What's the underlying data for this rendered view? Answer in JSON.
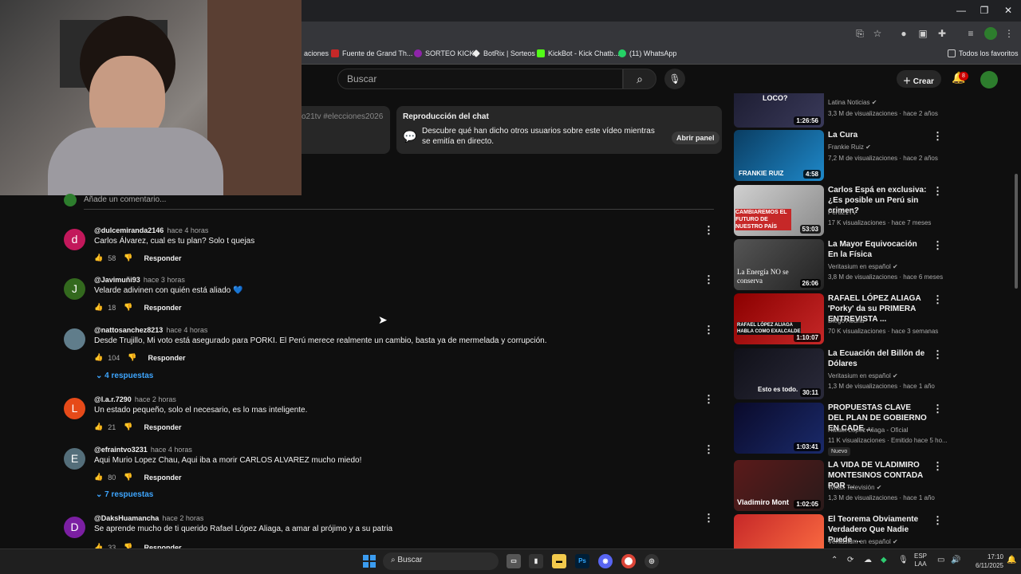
{
  "browser": {
    "bookmarks": [
      "aciones",
      "Fuente de Grand Th...",
      "SORTEO KICK",
      "BotRix | Sorteos",
      "KickBot - Kick Chatb...",
      "(11) WhatsApp"
    ],
    "all_bookmarks": "Todos los favoritos"
  },
  "header": {
    "search_placeholder": "Buscar",
    "create": "Crear",
    "notif_count": "8"
  },
  "chat_card": {
    "left_partial": "o21tv #elecciones2026",
    "title": "Reproducción del chat",
    "description": "Descubre qué han dicho otros usuarios sobre este vídeo mientras se emitía en directo.",
    "button": "Abrir panel"
  },
  "add_comment_placeholder": "Añade un comentario...",
  "comments": [
    {
      "initial": "d",
      "color": "#c2185b",
      "author": "@dulcemiranda2146",
      "time": "hace 4 horas",
      "text": "Carlos Álvarez, cual es tu plan? Solo t quejas",
      "likes": "58",
      "reply": "Responder"
    },
    {
      "initial": "J",
      "color": "#33691e",
      "author": "@Javimuñi93",
      "time": "hace 3 horas",
      "text": "Velarde adivinen con quién está aliado 💙",
      "likes": "18",
      "reply": "Responder"
    },
    {
      "initial": "",
      "color": "#607d8b",
      "author": "@nattosanchez8213",
      "time": "hace 4 horas",
      "text": "Desde Trujillo, Mi voto está asegurado para PORKI. El Perú merece realmente un cambio, basta ya de mermelada y corrupción.",
      "likes": "104",
      "reply": "Responder",
      "replies": "4 respuestas"
    },
    {
      "initial": "L",
      "color": "#e64a19",
      "author": "@l.a.r.7290",
      "time": "hace 2 horas",
      "text": "Un estado pequeño, solo el necesario, es lo mas inteligente.",
      "likes": "21",
      "reply": "Responder"
    },
    {
      "initial": "E",
      "color": "#546e7a",
      "author": "@efraintvo3231",
      "time": "hace 4 horas",
      "text": "Aqui Murio Lopez Chau, Aqui iba a morir CARLOS ALVAREZ mucho miedo!",
      "likes": "80",
      "reply": "Responder",
      "replies": "7 respuestas"
    },
    {
      "initial": "D",
      "color": "#7b1fa2",
      "author": "@DaksHuamancha",
      "time": "hace 2 horas",
      "text": "Se aprende mucho de ti querido Rafael López Aliaga, a amar al prójimo y a su patria",
      "likes": "33",
      "reply": "Responder"
    }
  ],
  "sidebar": [
    {
      "title": "",
      "channel": "Latina Noticias",
      "views": "3,3 M de visualizaciones · hace 2 años",
      "duration": "1:26:56",
      "thumb_text": "LOCO?",
      "colors": [
        "#1a1a2e",
        "#3a3a5a"
      ]
    },
    {
      "title": "La Cura",
      "channel": "Frankie Ruiz",
      "views": "7,2 M de visualizaciones · hace 2 años",
      "duration": "4:58",
      "thumb_text": "FRANKIE RUIZ",
      "colors": [
        "#0a3d62",
        "#1e88c9"
      ]
    },
    {
      "title": "Carlos Espá en exclusiva: ¿Es posible un Perú sin crimen?",
      "channel": "Peru21TV",
      "views": "17 K visualizaciones · hace 7 meses",
      "duration": "53:03",
      "thumb_text": "CAMBIAREMOS EL FUTURO DE NUESTRO PAÍS",
      "colors": [
        "#d0d0d0",
        "#8a8a8a"
      ]
    },
    {
      "title": "La Mayor Equivocación En la Física",
      "channel": "Veritasium en español",
      "views": "3,8 M de visualizaciones · hace 6 meses",
      "duration": "26:06",
      "thumb_text": "La Energía NO se conserva",
      "colors": [
        "#555",
        "#222"
      ]
    },
    {
      "title": "RAFAEL LÓPEZ ALIAGA 'Porky' da su PRIMERA ENTREVISTA ...",
      "channel": "Diego Acuña",
      "views": "70 K visualizaciones · hace 3 semanas",
      "duration": "1:10:07",
      "thumb_text": "RAFAEL LÓPEZ ALIAGA HABLA COMO EXALCALDE",
      "colors": [
        "#8b0000",
        "#c62828"
      ]
    },
    {
      "title": "La Ecuación del Billón de Dólares",
      "channel": "Veritasium en español",
      "views": "1,3 M de visualizaciones · hace 1 año",
      "duration": "30:11",
      "thumb_text": "Esto es todo.",
      "colors": [
        "#101018",
        "#2a2a3a"
      ]
    },
    {
      "title": "PROPUESTAS CLAVE DEL PLAN DE GOBIERNO EN CADE ...",
      "channel": "Rafael Lopez Aliaga - Oficial",
      "views": "11 K visualizaciones · Emitido hace 5 ho...",
      "duration": "1:03:41",
      "thumb_text": "",
      "badge": "Nuevo",
      "colors": [
        "#0a0a2a",
        "#1a2a6a"
      ]
    },
    {
      "title": "LA VIDA DE VLADIMIRO MONTESINOS CONTADA POR ...",
      "channel": "Willax Televisión",
      "views": "1,3 M de visualizaciones · hace 1 año",
      "duration": "1:02:05",
      "thumb_text": "Vladimiro Mont",
      "colors": [
        "#5a1a1a",
        "#2a1a1a"
      ]
    },
    {
      "title": "El Teorema Obviamente Verdadero Que Nadie Puede ...",
      "channel": "Veritasium en español",
      "views": "",
      "duration": "",
      "thumb_text": "",
      "colors": [
        "#c62828",
        "#ff7043"
      ]
    }
  ],
  "taskbar": {
    "search": "Buscar",
    "lang": "ESP",
    "lang2": "LAA",
    "time": "17:10",
    "date": "6/11/2025"
  }
}
